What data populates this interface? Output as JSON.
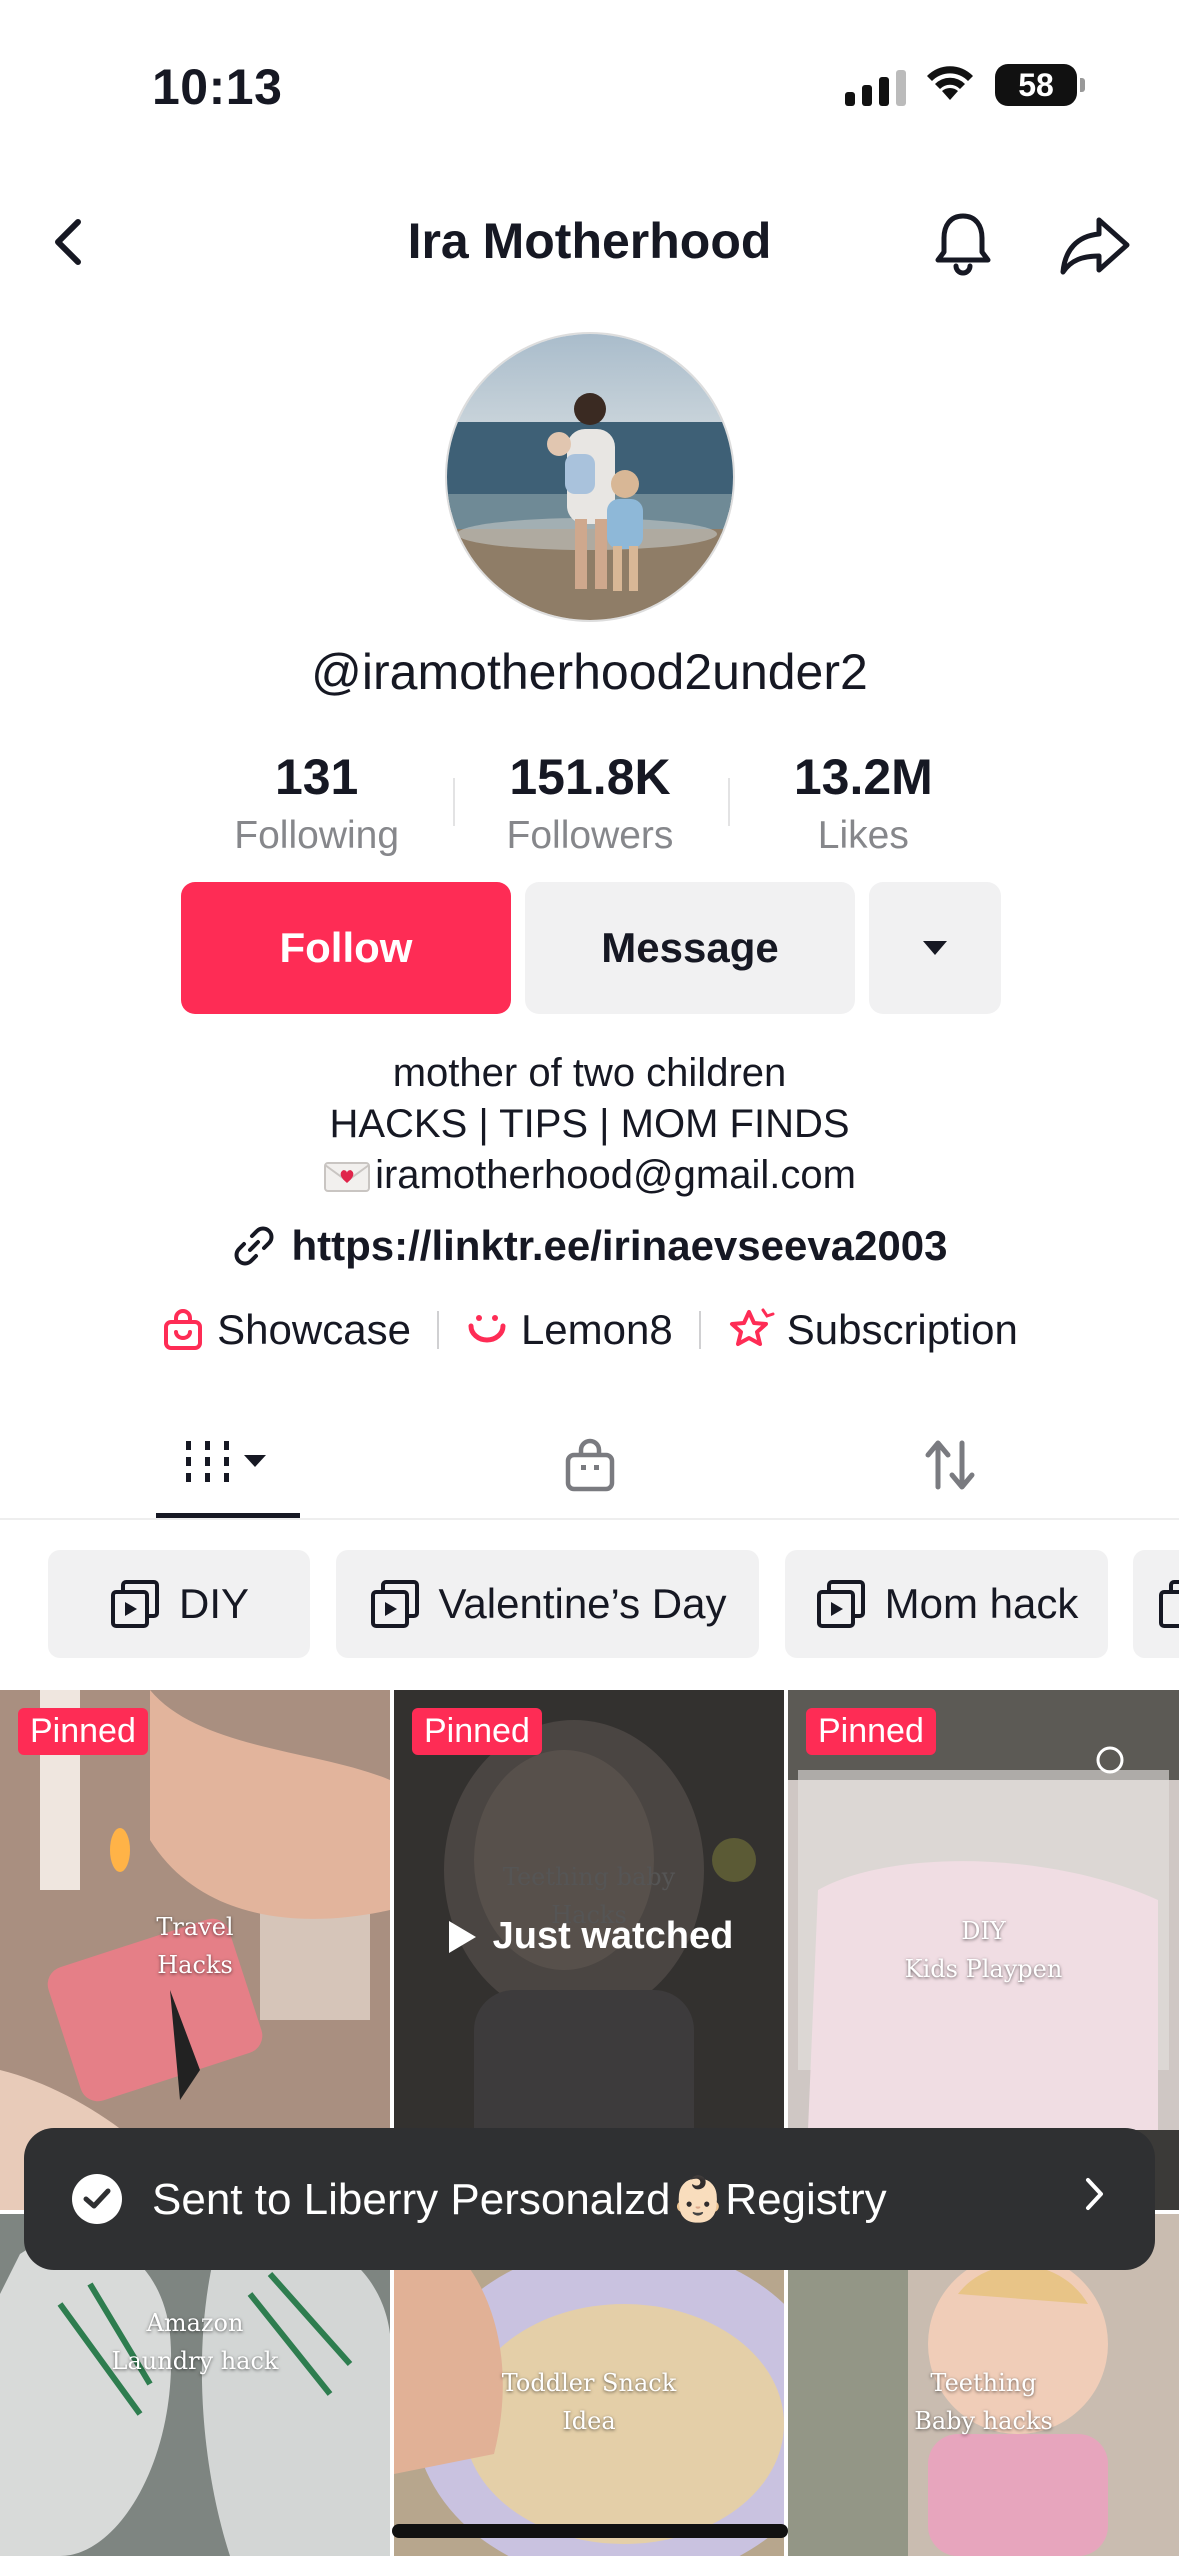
{
  "status_bar": {
    "time": "10:13",
    "battery": "58"
  },
  "header": {
    "title": "Ira Motherhood"
  },
  "profile": {
    "username": "@iramotherhood2under2",
    "stats": [
      {
        "value": "131",
        "label": "Following"
      },
      {
        "value": "151.8K",
        "label": "Followers"
      },
      {
        "value": "13.2M",
        "label": "Likes"
      }
    ],
    "buttons": {
      "follow": "Follow",
      "message": "Message"
    },
    "bio": {
      "line1": "mother of two children",
      "line2": "HACKS | TIPS | MOM FINDS",
      "email": "iramotherhood@gmail.com"
    },
    "link": "https://linktr.ee/irinaevseeva2003",
    "chips": [
      {
        "label": "Showcase",
        "icon": "shopping-bag-icon"
      },
      {
        "label": "Lemon8",
        "icon": "lemon8-icon"
      },
      {
        "label": "Subscription",
        "icon": "subscription-star-icon"
      }
    ]
  },
  "tabs": [
    {
      "name": "videos",
      "icon": "grid-icon"
    },
    {
      "name": "shop",
      "icon": "shopping-bag-icon"
    },
    {
      "name": "reposts",
      "icon": "repost-icon"
    }
  ],
  "collections": [
    "DIY",
    "Valentine’s Day",
    "Mom hack"
  ],
  "videos": [
    {
      "pinned": "Pinned",
      "caption": "Travel\nHacks"
    },
    {
      "pinned": "Pinned",
      "caption": "Teething baby\nHacks",
      "status": "Just watched"
    },
    {
      "pinned": "Pinned",
      "caption": "DIY\nKids Playpen"
    },
    {
      "caption": "Amazon\nLaundry hack"
    },
    {
      "caption": "Toddler Snack\nIdea"
    },
    {
      "caption": "Teething\nBaby hacks"
    }
  ],
  "toast": {
    "text": "Sent to Liberry Personalzd👶🏻Registry"
  },
  "colors": {
    "accent": "#fe2c55",
    "text": "#161823",
    "muted": "#86878b",
    "button_bg": "#f1f1f2"
  }
}
